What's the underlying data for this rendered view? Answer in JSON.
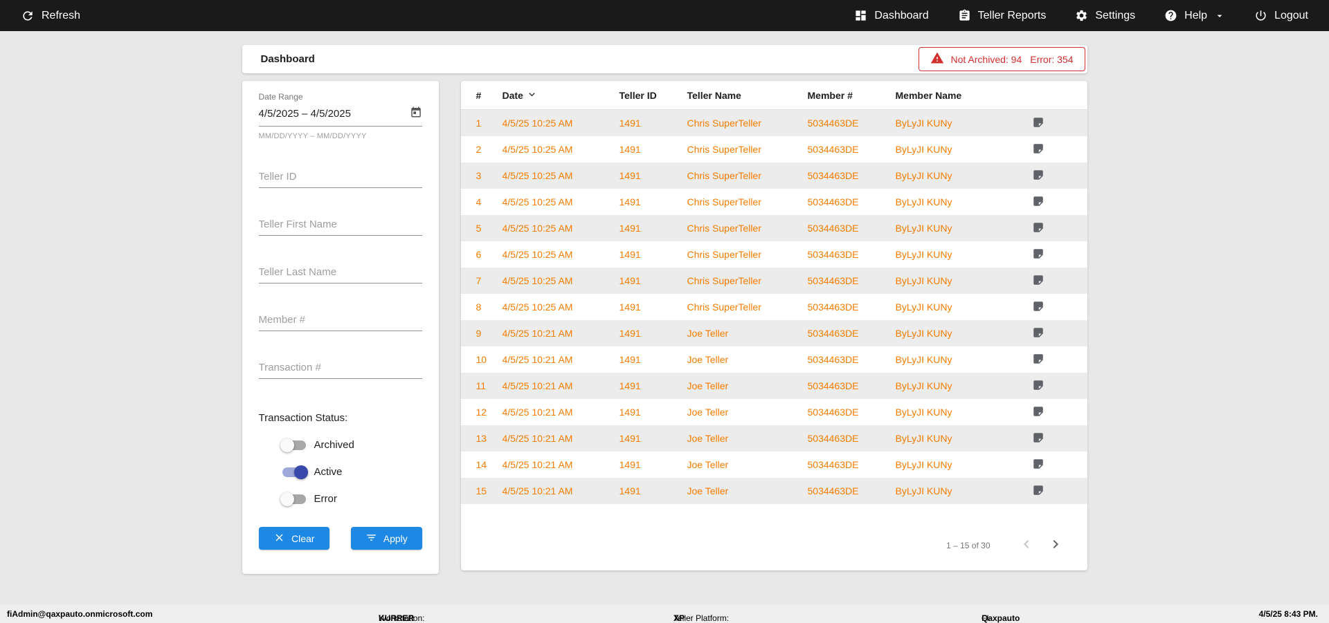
{
  "topbar": {
    "refresh_label": "Refresh",
    "nav": [
      {
        "label": "Dashboard"
      },
      {
        "label": "Teller Reports"
      },
      {
        "label": "Settings"
      },
      {
        "label": "Help"
      },
      {
        "label": "Logout"
      }
    ]
  },
  "header": {
    "title": "Dashboard",
    "alert": {
      "not_archived": "Not Archived: 94",
      "error": "Error: 354"
    }
  },
  "filters": {
    "date_range": {
      "label": "Date Range",
      "value": "4/5/2025 – 4/5/2025",
      "hint": "MM/DD/YYYY – MM/DD/YYYY"
    },
    "fields": [
      {
        "placeholder": "Teller ID"
      },
      {
        "placeholder": "Teller First Name"
      },
      {
        "placeholder": "Teller Last Name"
      },
      {
        "placeholder": "Member #"
      },
      {
        "placeholder": "Transaction #"
      }
    ],
    "status": {
      "label": "Transaction Status:",
      "toggles": [
        {
          "label": "Archived",
          "on": false
        },
        {
          "label": "Active",
          "on": true
        },
        {
          "label": "Error",
          "on": false
        }
      ]
    },
    "buttons": {
      "clear": "Clear",
      "apply": "Apply"
    }
  },
  "table": {
    "columns": [
      "#",
      "Date",
      "Teller ID",
      "Teller Name",
      "Member #",
      "Member Name"
    ],
    "sorted_by": "Date",
    "rows": [
      {
        "num": "1",
        "date": "4/5/25 10:25 AM",
        "teller_id": "1491",
        "teller_name": "Chris SuperTeller",
        "member_num": "5034463DE",
        "member_name": "ByLyJI KUNy"
      },
      {
        "num": "2",
        "date": "4/5/25 10:25 AM",
        "teller_id": "1491",
        "teller_name": "Chris SuperTeller",
        "member_num": "5034463DE",
        "member_name": "ByLyJI KUNy"
      },
      {
        "num": "3",
        "date": "4/5/25 10:25 AM",
        "teller_id": "1491",
        "teller_name": "Chris SuperTeller",
        "member_num": "5034463DE",
        "member_name": "ByLyJI KUNy"
      },
      {
        "num": "4",
        "date": "4/5/25 10:25 AM",
        "teller_id": "1491",
        "teller_name": "Chris SuperTeller",
        "member_num": "5034463DE",
        "member_name": "ByLyJI KUNy"
      },
      {
        "num": "5",
        "date": "4/5/25 10:25 AM",
        "teller_id": "1491",
        "teller_name": "Chris SuperTeller",
        "member_num": "5034463DE",
        "member_name": "ByLyJI KUNy"
      },
      {
        "num": "6",
        "date": "4/5/25 10:25 AM",
        "teller_id": "1491",
        "teller_name": "Chris SuperTeller",
        "member_num": "5034463DE",
        "member_name": "ByLyJI KUNy"
      },
      {
        "num": "7",
        "date": "4/5/25 10:25 AM",
        "teller_id": "1491",
        "teller_name": "Chris SuperTeller",
        "member_num": "5034463DE",
        "member_name": "ByLyJI KUNy"
      },
      {
        "num": "8",
        "date": "4/5/25 10:25 AM",
        "teller_id": "1491",
        "teller_name": "Chris SuperTeller",
        "member_num": "5034463DE",
        "member_name": "ByLyJI KUNy"
      },
      {
        "num": "9",
        "date": "4/5/25 10:21 AM",
        "teller_id": "1491",
        "teller_name": "Joe Teller",
        "member_num": "5034463DE",
        "member_name": "ByLyJI KUNy"
      },
      {
        "num": "10",
        "date": "4/5/25 10:21 AM",
        "teller_id": "1491",
        "teller_name": "Joe Teller",
        "member_num": "5034463DE",
        "member_name": "ByLyJI KUNy"
      },
      {
        "num": "11",
        "date": "4/5/25 10:21 AM",
        "teller_id": "1491",
        "teller_name": "Joe Teller",
        "member_num": "5034463DE",
        "member_name": "ByLyJI KUNy"
      },
      {
        "num": "12",
        "date": "4/5/25 10:21 AM",
        "teller_id": "1491",
        "teller_name": "Joe Teller",
        "member_num": "5034463DE",
        "member_name": "ByLyJI KUNy"
      },
      {
        "num": "13",
        "date": "4/5/25 10:21 AM",
        "teller_id": "1491",
        "teller_name": "Joe Teller",
        "member_num": "5034463DE",
        "member_name": "ByLyJI KUNy"
      },
      {
        "num": "14",
        "date": "4/5/25 10:21 AM",
        "teller_id": "1491",
        "teller_name": "Joe Teller",
        "member_num": "5034463DE",
        "member_name": "ByLyJI KUNy"
      },
      {
        "num": "15",
        "date": "4/5/25 10:21 AM",
        "teller_id": "1491",
        "teller_name": "Joe Teller",
        "member_num": "5034463DE",
        "member_name": "ByLyJI KUNy"
      }
    ],
    "pagination": {
      "range_label": "1 – 15 of 30"
    }
  },
  "footer": {
    "user_email": "fiAdmin@qaxpauto.onmicrosoft.com",
    "workstation_label": "Workstation:",
    "workstation_value": "KURRER",
    "platform_label": "Teller Platform:",
    "platform_value": "XP",
    "fi_label": "FI:",
    "fi_value": "Qaxpauto",
    "datetime": "4/5/25 8:43 PM."
  },
  "colors": {
    "accent_orange": "#F57C00",
    "accent_blue": "#1E88E5",
    "alert_red": "#D32F2F",
    "toggle_on": "#3949AB",
    "topbar_bg": "#1A1A1A"
  }
}
